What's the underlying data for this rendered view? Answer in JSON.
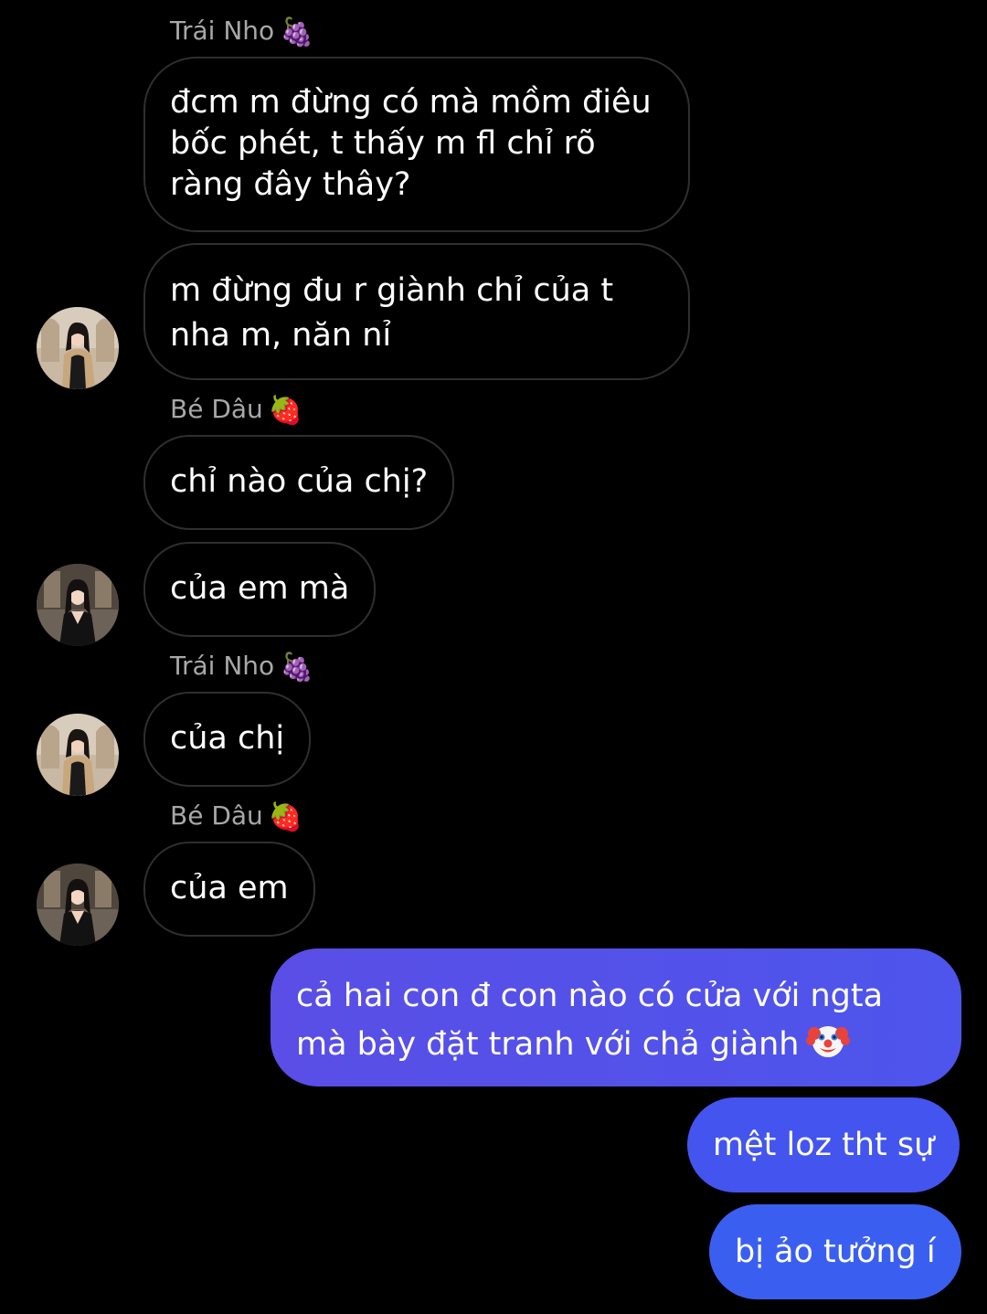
{
  "messages": [
    {
      "sender": "Trái Nho",
      "sender_emoji": "🍇",
      "text": "đcm m đừng có mà mồm điêu bốc phét, t thấy m fl chỉ rõ ràng đây thây?"
    },
    {
      "text": "m đừng đu r giành chỉ của t nha m, năn nỉ"
    },
    {
      "sender": "Bé Dâu",
      "sender_emoji": "🍓",
      "text": "chỉ nào của chị?"
    },
    {
      "text": "của em mà"
    },
    {
      "sender": "Trái Nho",
      "sender_emoji": "🍇",
      "text": "của chị"
    },
    {
      "sender": "Bé Dâu",
      "sender_emoji": "🍓",
      "text": "của em"
    }
  ],
  "outgoing": [
    {
      "text": "cả hai con đ con nào có cửa với ngta mà bày đặt tranh với chả giành",
      "emoji": "clown-face"
    },
    {
      "text": "mệt loz tht sự"
    },
    {
      "text": "bị ảo tưởng í"
    }
  ],
  "colors": {
    "background": "#000000",
    "incoming_border": "#2f2f2f",
    "sender_name": "#a8a8a8",
    "outgoing_gradient_start": "#5a4ee6",
    "outgoing_gradient_end": "#3a5ff0"
  }
}
